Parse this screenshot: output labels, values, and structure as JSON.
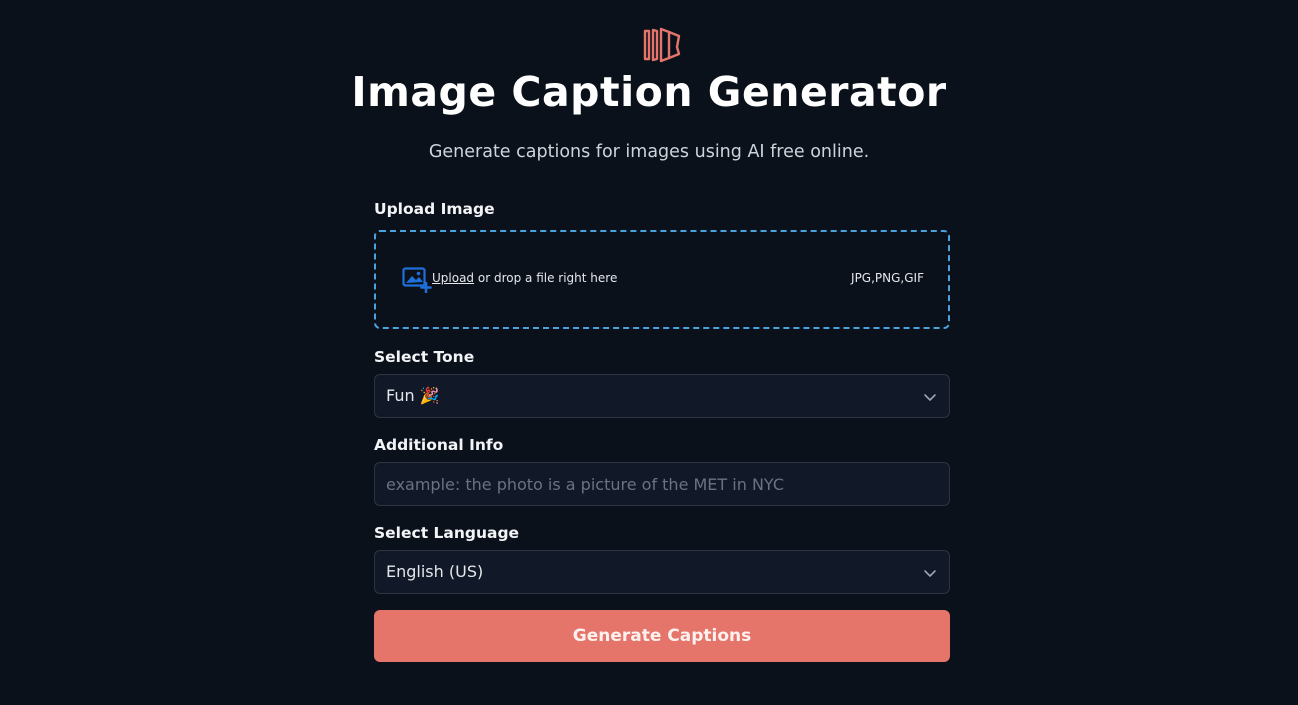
{
  "header": {
    "logo_icon": "book-pages-logo-icon",
    "title": "Image Caption Generator",
    "subtitle": "Generate captions for images using AI free online."
  },
  "upload": {
    "label": "Upload Image",
    "icon": "image-upload-icon",
    "link_text": "Upload",
    "hint_text": "or drop a file right here",
    "file_types": "JPG,PNG,GIF"
  },
  "tone": {
    "label": "Select Tone",
    "selected": "Fun 🎉"
  },
  "additional_info": {
    "label": "Additional Info",
    "placeholder": "example: the photo is a picture of the MET in NYC",
    "value": ""
  },
  "language": {
    "label": "Select Language",
    "selected": "English (US)"
  },
  "submit": {
    "label": "Generate Captions"
  },
  "colors": {
    "background": "#0b111b",
    "accent": "#e5756b",
    "dropzone_border": "#4aa3df",
    "upload_icon": "#1e6fd9"
  }
}
